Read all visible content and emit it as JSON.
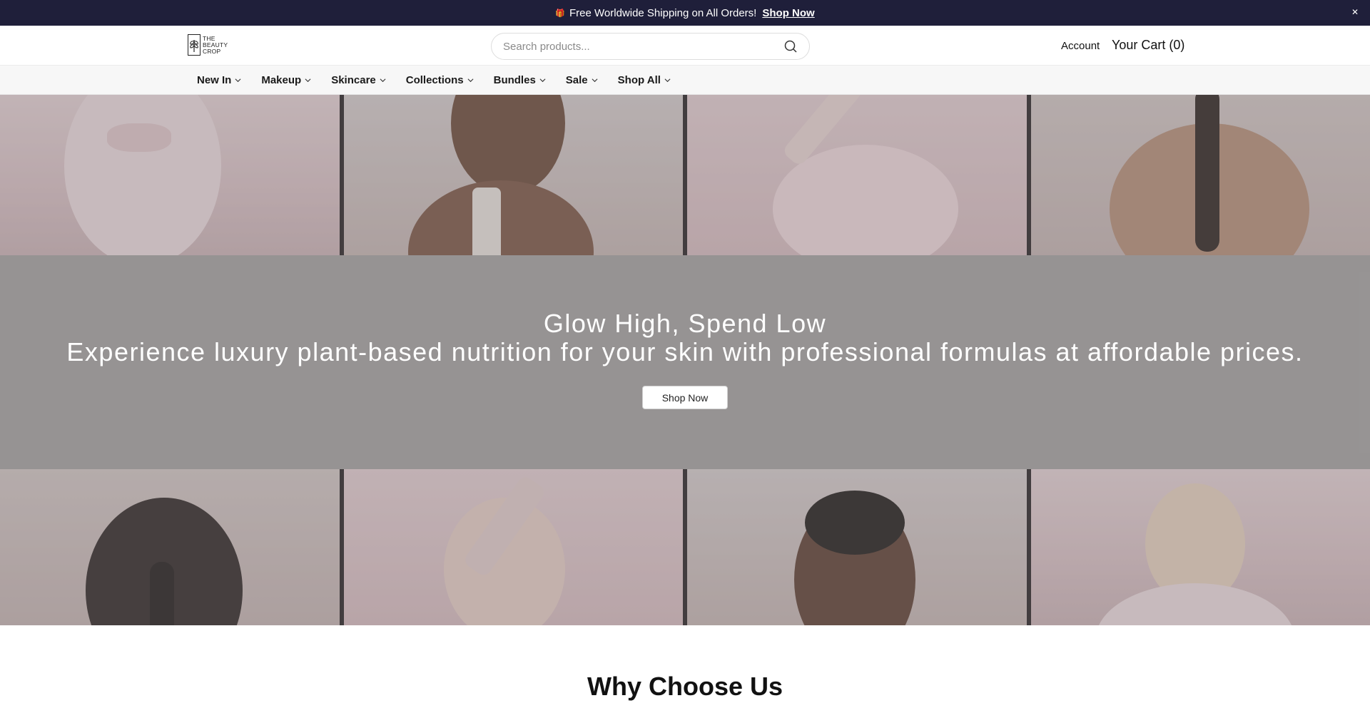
{
  "announcement": {
    "gift_icon": "gift-icon",
    "text": "Free Worldwide Shipping on All Orders!",
    "link": "Shop Now",
    "close_icon": "close-icon"
  },
  "header": {
    "logo_text": "THE BEAUTY CROP",
    "search": {
      "placeholder": "Search products...",
      "value": ""
    },
    "account_label": "Account",
    "cart_label": "Your Cart (0)"
  },
  "nav": {
    "items": [
      {
        "label": "New In"
      },
      {
        "label": "Makeup"
      },
      {
        "label": "Skincare"
      },
      {
        "label": "Collections"
      },
      {
        "label": "Bundles"
      },
      {
        "label": "Sale"
      },
      {
        "label": "Shop All"
      }
    ]
  },
  "hero": {
    "title": "Glow High, Spend Low",
    "subtitle": "Experience luxury plant-based nutrition for your skin with professional formulas at affordable prices.",
    "button_label": "Shop Now"
  },
  "section": {
    "why_title": "Why Choose Us"
  }
}
